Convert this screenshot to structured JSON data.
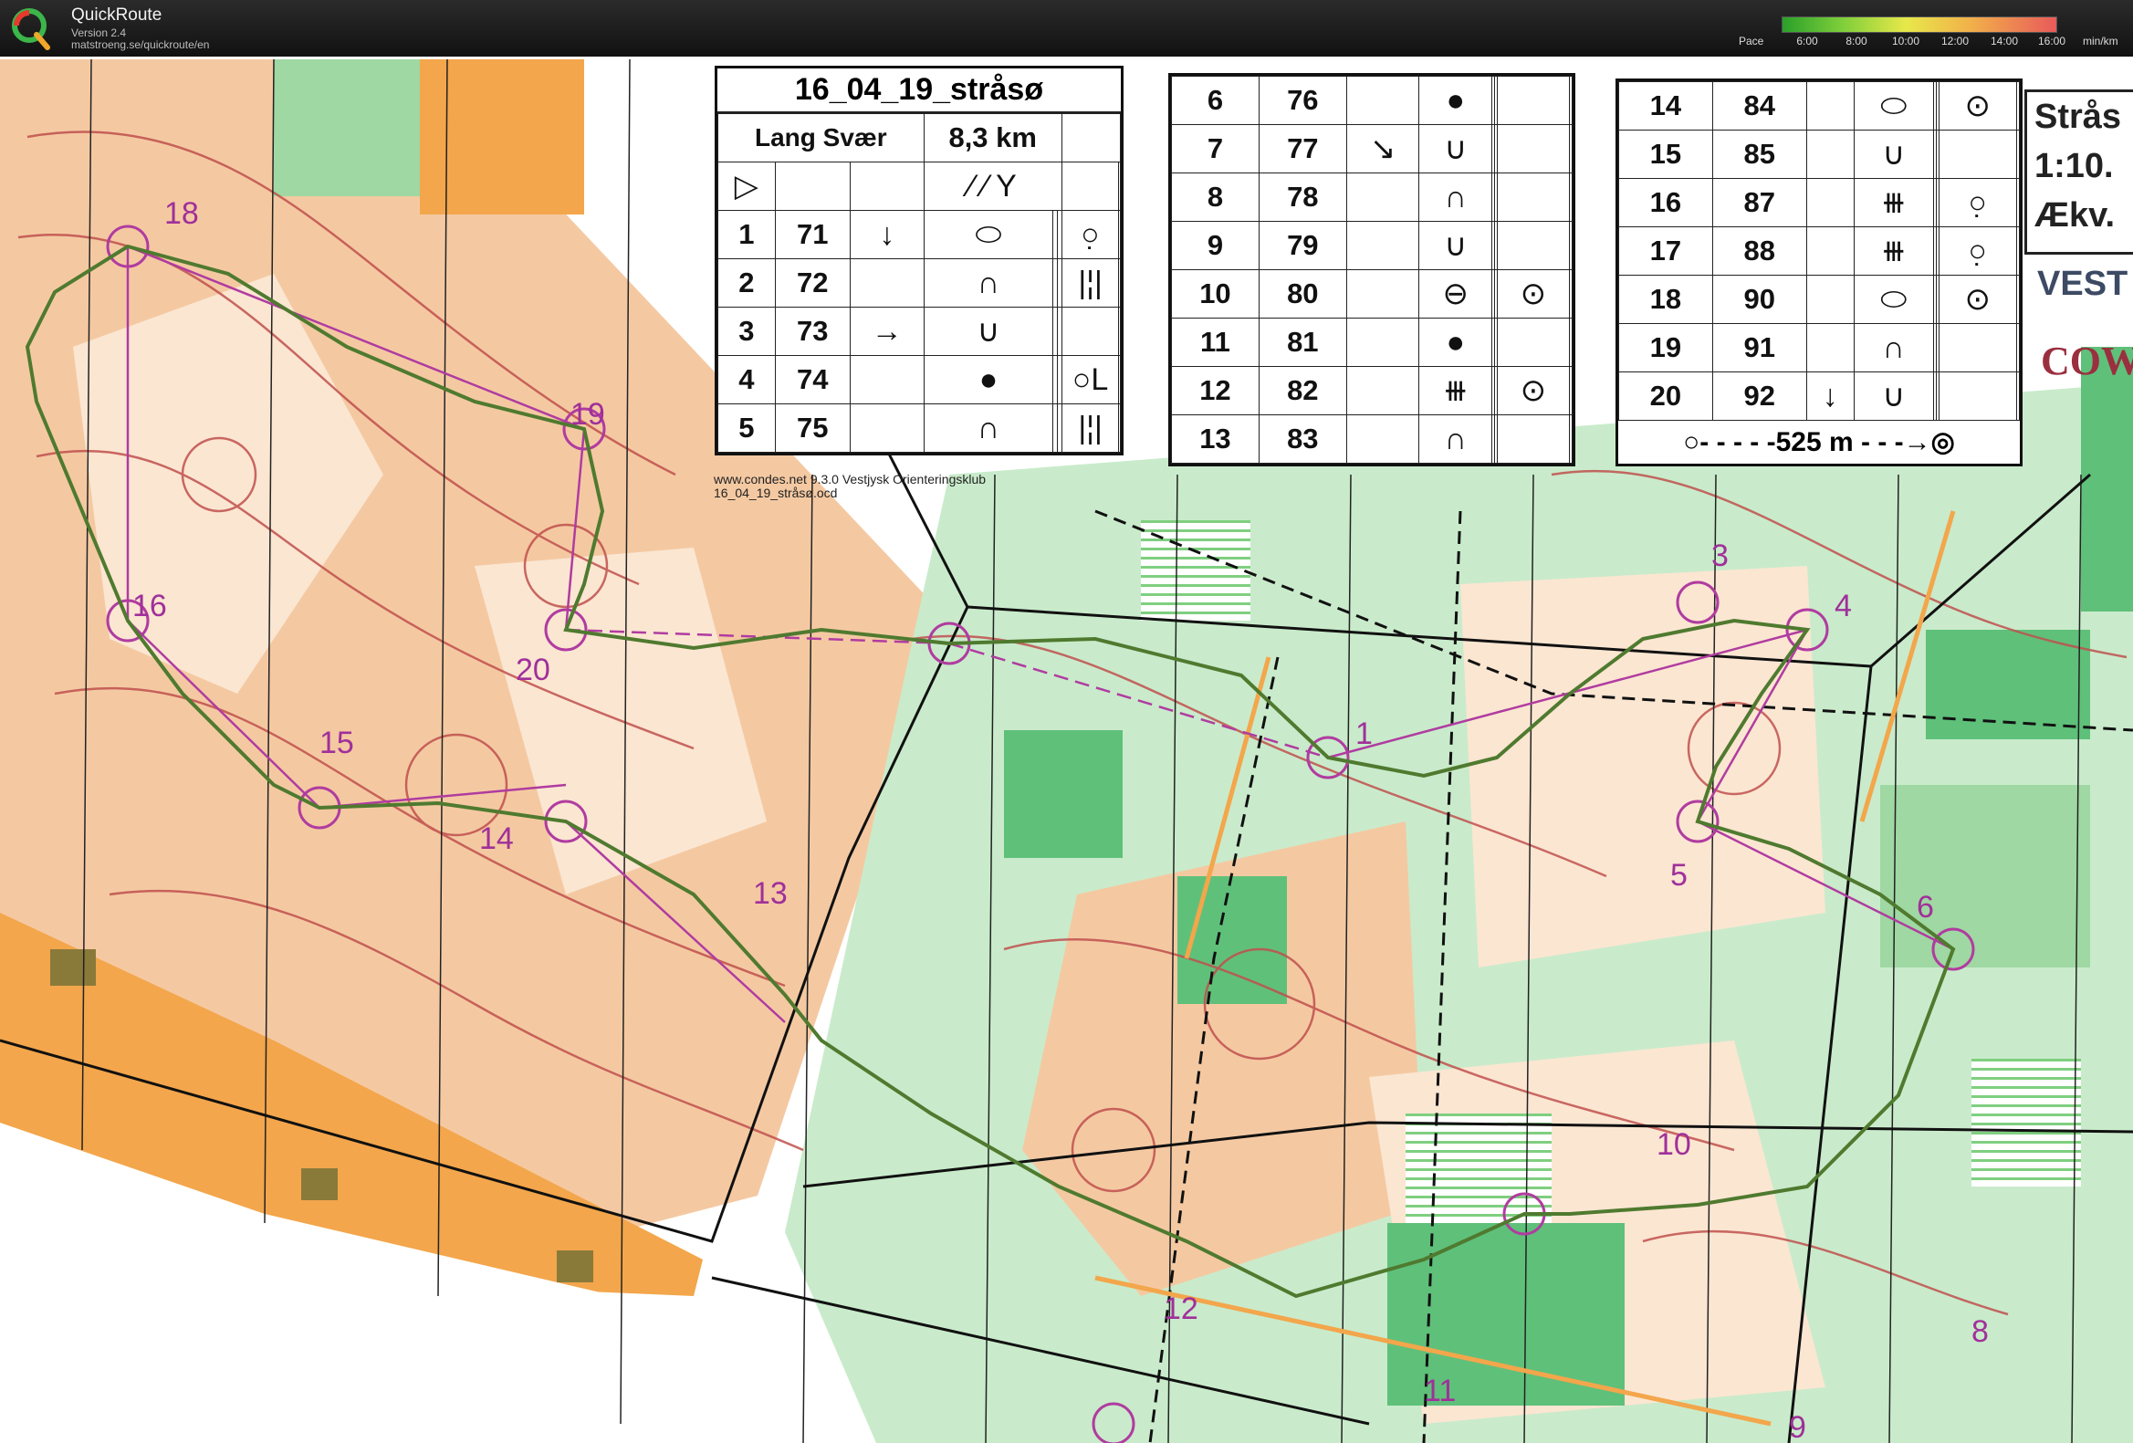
{
  "header": {
    "app_name": "QuickRoute",
    "version": "Version 2.4",
    "url": "matstroeng.se/quickroute/en",
    "pace_label": "Pace",
    "pace_ticks": [
      "6:00",
      "8:00",
      "10:00",
      "12:00",
      "14:00",
      "16:00"
    ],
    "pace_unit": "min/km"
  },
  "course": {
    "title": "16_04_19_stråsø",
    "class_name": "Lang Svær",
    "length": "8,3 km",
    "start_symbol": "▷",
    "controls": [
      {
        "n": "1",
        "code": "71",
        "dir": "↓",
        "feature": "⬭",
        "detail": "○̣"
      },
      {
        "n": "2",
        "code": "72",
        "dir": "",
        "feature": "∩",
        "detail": "|¦|"
      },
      {
        "n": "3",
        "code": "73",
        "dir": "→",
        "feature": "∪",
        "detail": ""
      },
      {
        "n": "4",
        "code": "74",
        "dir": "",
        "feature": "●",
        "detail": "○L"
      },
      {
        "n": "5",
        "code": "75",
        "dir": "",
        "feature": "∩",
        "detail": "|¦|"
      },
      {
        "n": "6",
        "code": "76",
        "dir": "",
        "feature": "●",
        "detail": ""
      },
      {
        "n": "7",
        "code": "77",
        "dir": "↘",
        "feature": "∪",
        "detail": ""
      },
      {
        "n": "8",
        "code": "78",
        "dir": "",
        "feature": "∩",
        "detail": ""
      },
      {
        "n": "9",
        "code": "79",
        "dir": "",
        "feature": "∪",
        "detail": ""
      },
      {
        "n": "10",
        "code": "80",
        "dir": "",
        "feature": "⊖",
        "detail": "⊙"
      },
      {
        "n": "11",
        "code": "81",
        "dir": "",
        "feature": "●",
        "detail": ""
      },
      {
        "n": "12",
        "code": "82",
        "dir": "",
        "feature": "⧻",
        "detail": "⊙"
      },
      {
        "n": "13",
        "code": "83",
        "dir": "",
        "feature": "∩",
        "detail": ""
      },
      {
        "n": "14",
        "code": "84",
        "dir": "",
        "feature": "⬭",
        "detail": "⊙"
      },
      {
        "n": "15",
        "code": "85",
        "dir": "",
        "feature": "∪",
        "detail": ""
      },
      {
        "n": "16",
        "code": "87",
        "dir": "",
        "feature": "⧻",
        "detail": "○̣"
      },
      {
        "n": "17",
        "code": "88",
        "dir": "",
        "feature": "⧻",
        "detail": "○̣"
      },
      {
        "n": "18",
        "code": "90",
        "dir": "",
        "feature": "⬭",
        "detail": "⊙"
      },
      {
        "n": "19",
        "code": "91",
        "dir": "",
        "feature": "∩",
        "detail": ""
      },
      {
        "n": "20",
        "code": "92",
        "dir": "↓",
        "feature": "∪",
        "detail": ""
      }
    ],
    "finish_text": "525 m"
  },
  "legend": {
    "line1": "Strås",
    "line2": "1:10.",
    "line3": "Ækv.",
    "vest": "VEST",
    "cow": "COW"
  },
  "software": {
    "credit": "www.condes.net 9.3.0 Vestjysk Orienteringsklub",
    "file": "16_04_19_stråsø.ocd"
  },
  "map_labels": [
    {
      "id": "1",
      "text": "1"
    },
    {
      "id": "3",
      "text": "3"
    },
    {
      "id": "4",
      "text": "4"
    },
    {
      "id": "5",
      "text": "5"
    },
    {
      "id": "6",
      "text": "6"
    },
    {
      "id": "8",
      "text": "8"
    },
    {
      "id": "9",
      "text": "9"
    },
    {
      "id": "10",
      "text": "10"
    },
    {
      "id": "11",
      "text": "11"
    },
    {
      "id": "12",
      "text": "12"
    },
    {
      "id": "13",
      "text": "13"
    },
    {
      "id": "14",
      "text": "14"
    },
    {
      "id": "15",
      "text": "15"
    },
    {
      "id": "16",
      "text": "16"
    },
    {
      "id": "18",
      "text": "18"
    },
    {
      "id": "19",
      "text": "19"
    },
    {
      "id": "20",
      "text": "20"
    }
  ],
  "colors": {
    "open_land": "#f4c9a2",
    "rough_open": "#fbe6d2",
    "forest_green": "#9fd8a2",
    "dense_green": "#5fc07a",
    "contour": "#c0504d",
    "course_purple": "#b03ca0",
    "route": "#4f7a2f",
    "track": "#111111",
    "orange_field": "#f3a64b"
  }
}
